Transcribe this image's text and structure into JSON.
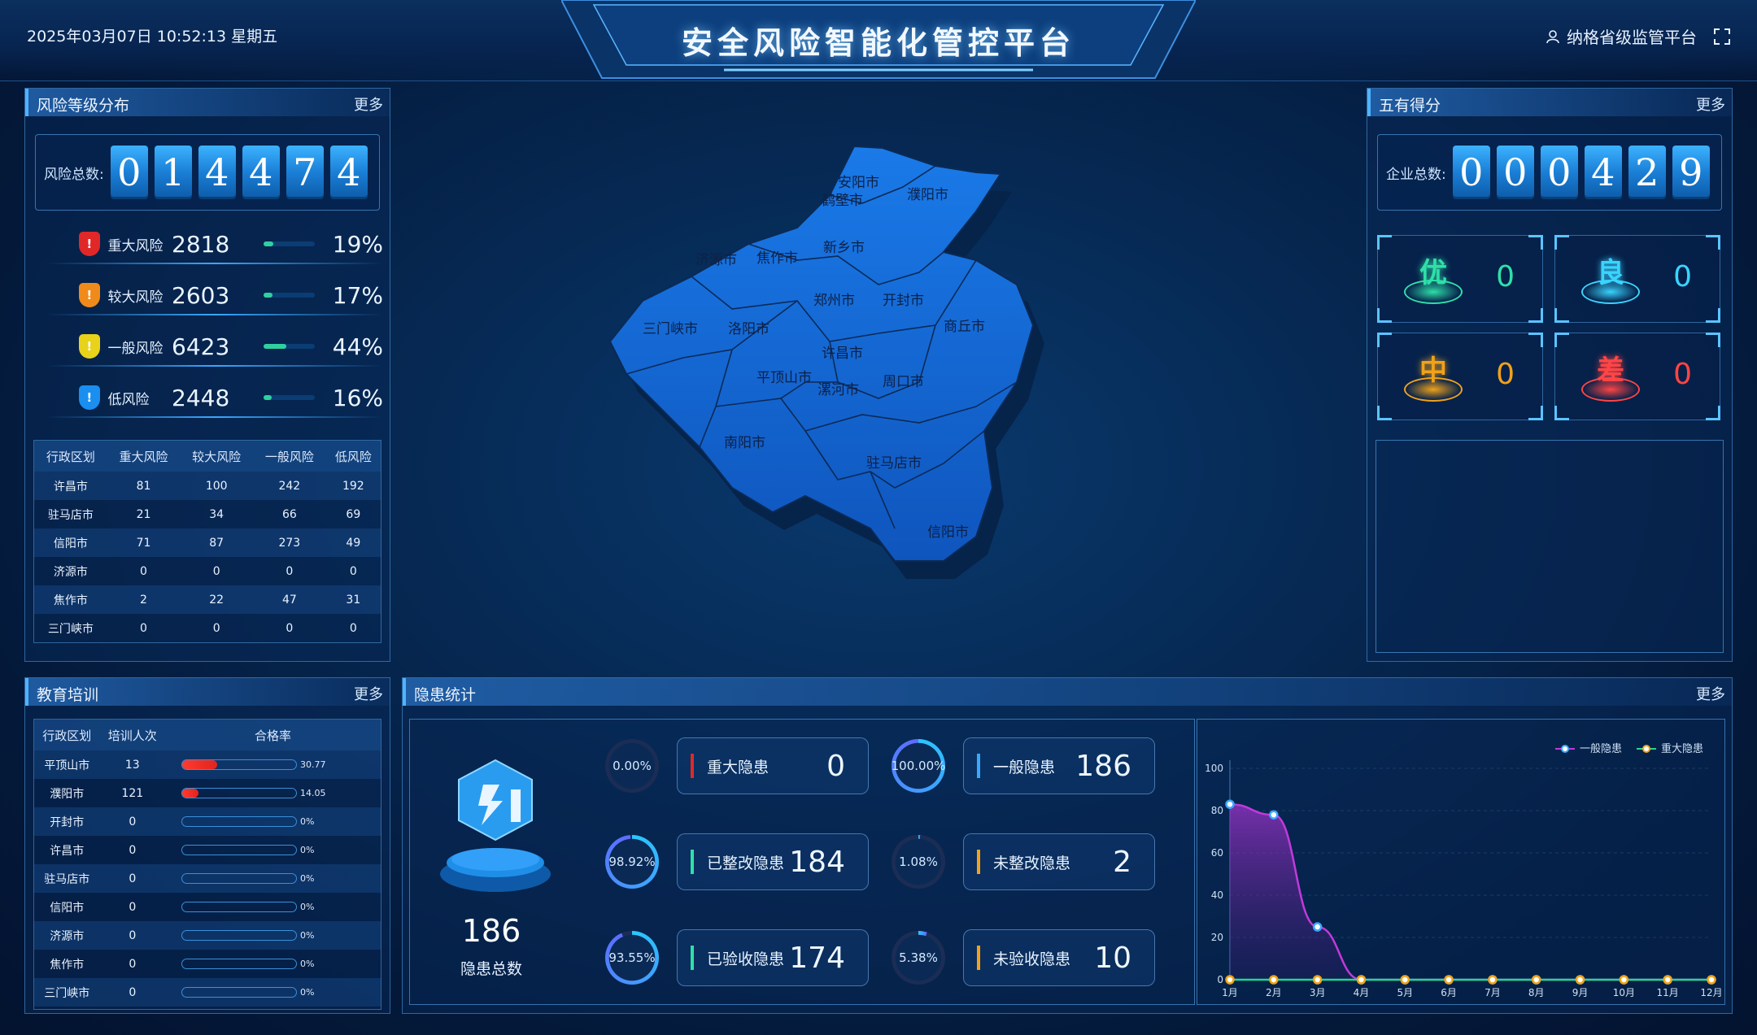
{
  "header": {
    "datetime": "2025年03月07日 10:52:13 星期五",
    "title": "安全风险智能化管控平台",
    "user": "纳格省级监管平台",
    "user_icon": "user-icon",
    "fullscreen_icon": "fullscreen-icon"
  },
  "risk_panel": {
    "title": "风险等级分布",
    "more": "更多",
    "total_label": "风险总数:",
    "total_digits": [
      "0",
      "1",
      "4",
      "4",
      "7",
      "4"
    ],
    "levels": [
      {
        "label": "重大风险",
        "count": "2818",
        "pct": "19%",
        "fraction": 0.19,
        "color": "#e02828"
      },
      {
        "label": "较大风险",
        "count": "2603",
        "pct": "17%",
        "fraction": 0.17,
        "color": "#f08a1a"
      },
      {
        "label": "一般风险",
        "count": "6423",
        "pct": "44%",
        "fraction": 0.44,
        "color": "#e8d21a"
      },
      {
        "label": "低风险",
        "count": "2448",
        "pct": "16%",
        "fraction": 0.16,
        "color": "#1a8ff0"
      }
    ],
    "table": {
      "headers": [
        "行政区划",
        "重大风险",
        "较大风险",
        "一般风险",
        "低风险"
      ],
      "rows": [
        [
          "许昌市",
          "81",
          "100",
          "242",
          "192"
        ],
        [
          "驻马店市",
          "21",
          "34",
          "66",
          "69"
        ],
        [
          "信阳市",
          "71",
          "87",
          "273",
          "49"
        ],
        [
          "济源市",
          "0",
          "0",
          "0",
          "0"
        ],
        [
          "焦作市",
          "2",
          "22",
          "47",
          "31"
        ],
        [
          "三门峡市",
          "0",
          "0",
          "0",
          "0"
        ]
      ]
    }
  },
  "training_panel": {
    "title": "教育培训",
    "more": "更多",
    "headers": [
      "行政区划",
      "培训人次",
      "合格率"
    ],
    "rows": [
      {
        "region": "平顶山市",
        "count": "13",
        "rate": "30.77",
        "fraction": 0.3077
      },
      {
        "region": "濮阳市",
        "count": "121",
        "rate": "14.05",
        "fraction": 0.1405
      },
      {
        "region": "开封市",
        "count": "0",
        "rate": "0%",
        "fraction": 0
      },
      {
        "region": "许昌市",
        "count": "0",
        "rate": "0%",
        "fraction": 0
      },
      {
        "region": "驻马店市",
        "count": "0",
        "rate": "0%",
        "fraction": 0
      },
      {
        "region": "信阳市",
        "count": "0",
        "rate": "0%",
        "fraction": 0
      },
      {
        "region": "济源市",
        "count": "0",
        "rate": "0%",
        "fraction": 0
      },
      {
        "region": "焦作市",
        "count": "0",
        "rate": "0%",
        "fraction": 0
      },
      {
        "region": "三门峡市",
        "count": "0",
        "rate": "0%",
        "fraction": 0
      }
    ]
  },
  "map": {
    "cities": [
      "安阳市",
      "鹤壁市",
      "濮阳市",
      "新乡市",
      "济源市",
      "焦作市",
      "郑州市",
      "开封市",
      "三门峡市",
      "洛阳市",
      "商丘市",
      "许昌市",
      "平顶山市",
      "漯河市",
      "周口市",
      "南阳市",
      "驻马店市",
      "信阳市"
    ],
    "fill_color": "#1565d0"
  },
  "score_panel": {
    "title": "五有得分",
    "more": "更多",
    "total_label": "企业总数:",
    "total_digits": [
      "0",
      "0",
      "0",
      "4",
      "2",
      "9"
    ],
    "grades": [
      {
        "char": "优",
        "value": "0",
        "color": "#2fe0a8"
      },
      {
        "char": "良",
        "value": "0",
        "color": "#3ad4ff"
      },
      {
        "char": "中",
        "value": "0",
        "color": "#f0a21a"
      },
      {
        "char": "差",
        "value": "0",
        "color": "#ff4545"
      }
    ]
  },
  "hazard_panel": {
    "title": "隐患统计",
    "more": "更多",
    "total_value": "186",
    "total_label": "隐患总数",
    "items": [
      {
        "ring": "0.00%",
        "fraction": 0.0,
        "label": "重大隐患",
        "value": "0",
        "mark_color": "#e02828"
      },
      {
        "ring": "100.00%",
        "fraction": 1.0,
        "label": "一般隐患",
        "value": "186",
        "mark_color": "#3aa8ff"
      },
      {
        "ring": "98.92%",
        "fraction": 0.9892,
        "label": "已整改隐患",
        "value": "184",
        "mark_color": "#2fe0a8"
      },
      {
        "ring": "1.08%",
        "fraction": 0.0108,
        "label": "未整改隐患",
        "value": "2",
        "mark_color": "#f0a21a"
      },
      {
        "ring": "93.55%",
        "fraction": 0.9355,
        "label": "已验收隐患",
        "value": "174",
        "mark_color": "#2fe0a8"
      },
      {
        "ring": "5.38%",
        "fraction": 0.0538,
        "label": "未验收隐患",
        "value": "10",
        "mark_color": "#f0a21a"
      }
    ]
  },
  "chart_data": {
    "type": "area",
    "x": [
      "1月",
      "2月",
      "3月",
      "4月",
      "5月",
      "6月",
      "7月",
      "8月",
      "9月",
      "10月",
      "11月",
      "12月"
    ],
    "ylim": [
      0,
      100
    ],
    "yticks": [
      "0",
      "20",
      "40",
      "60",
      "80",
      "100"
    ],
    "legend": "top-right",
    "series": [
      {
        "name": "一般隐患",
        "values": [
          83,
          78,
          25,
          0,
          0,
          0,
          0,
          0,
          0,
          0,
          0,
          0
        ],
        "color": "#c23ad9"
      },
      {
        "name": "重大隐患",
        "values": [
          0,
          0,
          0,
          0,
          0,
          0,
          0,
          0,
          0,
          0,
          0,
          0
        ],
        "color": "#1fd890"
      }
    ]
  }
}
